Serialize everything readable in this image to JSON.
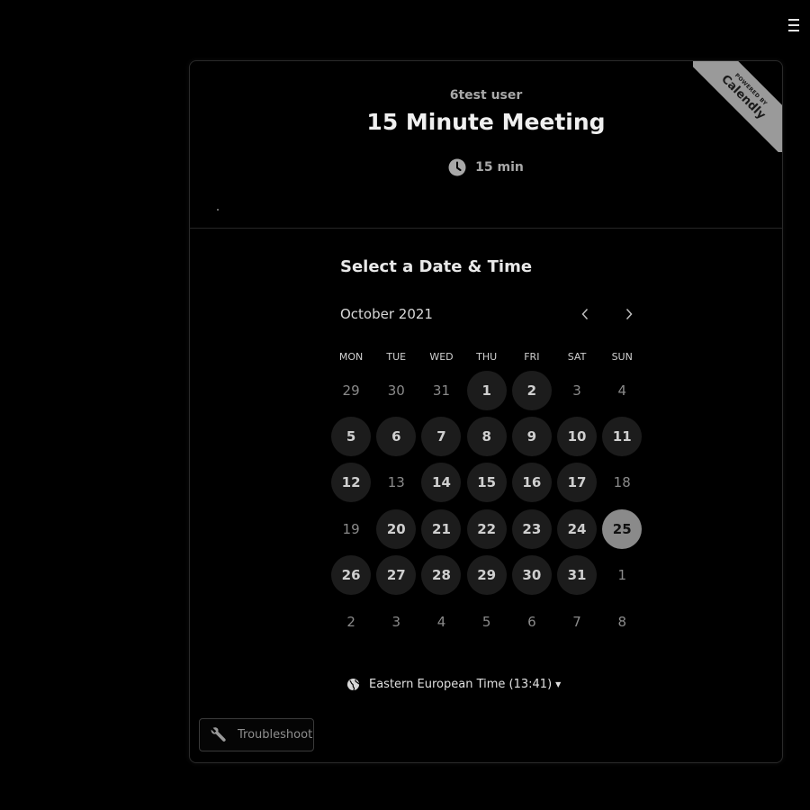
{
  "owner_name": "6test user",
  "event": {
    "title": "15 Minute Meeting",
    "duration": "15 min"
  },
  "badge": {
    "powered_by": "POWERED BY",
    "brand": "Calendly"
  },
  "scheduler": {
    "heading": "Select a Date & Time",
    "month_label": "October 2021",
    "weekdays": [
      "MON",
      "TUE",
      "WED",
      "THU",
      "FRI",
      "SAT",
      "SUN"
    ],
    "weeks": [
      [
        {
          "d": "29",
          "s": "off"
        },
        {
          "d": "30",
          "s": "off"
        },
        {
          "d": "31",
          "s": "off"
        },
        {
          "d": "1",
          "s": "avail"
        },
        {
          "d": "2",
          "s": "avail"
        },
        {
          "d": "3",
          "s": "off"
        },
        {
          "d": "4",
          "s": "off"
        }
      ],
      [
        {
          "d": "5",
          "s": "avail"
        },
        {
          "d": "6",
          "s": "avail"
        },
        {
          "d": "7",
          "s": "avail"
        },
        {
          "d": "8",
          "s": "avail"
        },
        {
          "d": "9",
          "s": "avail"
        },
        {
          "d": "10",
          "s": "avail"
        },
        {
          "d": "11",
          "s": "avail"
        }
      ],
      [
        {
          "d": "12",
          "s": "avail"
        },
        {
          "d": "13",
          "s": "off"
        },
        {
          "d": "14",
          "s": "avail"
        },
        {
          "d": "15",
          "s": "avail"
        },
        {
          "d": "16",
          "s": "avail"
        },
        {
          "d": "17",
          "s": "avail"
        },
        {
          "d": "18",
          "s": "off"
        }
      ],
      [
        {
          "d": "19",
          "s": "off"
        },
        {
          "d": "20",
          "s": "avail"
        },
        {
          "d": "21",
          "s": "avail"
        },
        {
          "d": "22",
          "s": "avail"
        },
        {
          "d": "23",
          "s": "avail"
        },
        {
          "d": "24",
          "s": "avail"
        },
        {
          "d": "25",
          "s": "today"
        }
      ],
      [
        {
          "d": "26",
          "s": "avail"
        },
        {
          "d": "27",
          "s": "avail"
        },
        {
          "d": "28",
          "s": "avail"
        },
        {
          "d": "29",
          "s": "avail"
        },
        {
          "d": "30",
          "s": "avail"
        },
        {
          "d": "31",
          "s": "avail"
        },
        {
          "d": "1",
          "s": "off"
        }
      ],
      [
        {
          "d": "2",
          "s": "off"
        },
        {
          "d": "3",
          "s": "off"
        },
        {
          "d": "4",
          "s": "off"
        },
        {
          "d": "5",
          "s": "off"
        },
        {
          "d": "6",
          "s": "off"
        },
        {
          "d": "7",
          "s": "off"
        },
        {
          "d": "8",
          "s": "off"
        }
      ]
    ]
  },
  "timezone": {
    "label": "Eastern European Time (13:41)",
    "icon": "globe-icon"
  },
  "troubleshoot": {
    "label": "Troubleshoot",
    "icon": "wrench-icon"
  },
  "colors": {
    "background": "#000000",
    "available_day": "#1c1c1c",
    "selected_day": "#8a8a8a",
    "ribbon": "#9a9a9a"
  }
}
